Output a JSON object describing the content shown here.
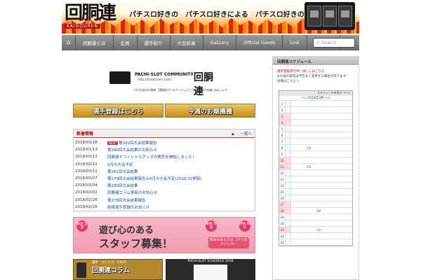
{
  "header": {
    "logo_text": "回胴連",
    "logo_sub": "KAIDOUREN",
    "tagline": "パチスロ好きの　パチスロ好きによる　パチスロ好きのための"
  },
  "nav": {
    "items": [
      "回胴連とは",
      "会員",
      "選手紹介",
      "大会結果",
      "GaLLery",
      "Official Goods",
      "Link",
      "お問合せ"
    ],
    "search_placeholder": "Search"
  },
  "community": {
    "name": "PACHI-SLOT COMMUNITY",
    "url": "http://kaidouren.com/",
    "kanji": "回胴連",
    "welcome": "パチスロ好きの皆様、回胴連のホームページへようこそ！パチスロを楽しみましょう！"
  },
  "banners": {
    "register": "選手登録はこちら",
    "theme": "今週のお題機種"
  },
  "news": {
    "title": "新着情報",
    "more": "一覧へ",
    "new_badge": "NEW!",
    "items": [
      {
        "date": "2018/03/18",
        "text": "第282回大会結果報告",
        "new": true
      },
      {
        "date": "2018/03/13",
        "text": "第280回大会結果のお知らせ",
        "new": false
      },
      {
        "date": "2018/03/13",
        "text": "回胴連オフィシャルグッズの販売を開始しました！",
        "new": false
      },
      {
        "date": "2018/03/12",
        "text": "5月の大会予定",
        "new": false
      },
      {
        "date": "2018/03/11",
        "text": "第281回大会結果",
        "new": false
      },
      {
        "date": "2018/03/07",
        "text": "第279回大会結果報告＆6月の大会予定(2018.02更新)",
        "new": false
      },
      {
        "date": "2018/03/04",
        "text": "第280回大会結果",
        "new": false
      },
      {
        "date": "2018/03/02",
        "text": "回胴連コラム更新のお知らせ",
        "new": false
      },
      {
        "date": "2018/02/28",
        "text": "第278回大会結果報告",
        "new": false
      },
      {
        "date": "2018/02/26",
        "text": "新規選手登録のお知らせ",
        "new": false
      }
    ]
  },
  "staff": {
    "badge_left": "動画 出演",
    "badge_right": "事務 作業",
    "badge_right2": "映像 制作",
    "line1": "遊び心のある",
    "line2": "スタッフ募集！",
    "apply": "興味のある方は コチラをクリック！"
  },
  "column": {
    "top": "選手　カントク　STAFF",
    "label": "回胴連コラム"
  },
  "schedule": {
    "title": "PACHI-SLOT SCHEDULE 2018"
  },
  "sidebar": {
    "title": "回胴連スケジュール",
    "notice1": "選手登録受付中！詳しくはこちら",
    "notice2": "※大会の日程は予告なく変更する場合があります",
    "notice3": "詳細はこちら＞",
    "cal_top": "スケジュールを見る >>>",
    "cal_month_prefix": "<< 2018年",
    "cal_month": "3月",
    "cal_month_suffix": " >>",
    "days": [
      {
        "d": "1",
        "hol": false,
        "text": ""
      },
      {
        "d": "2",
        "hol": false,
        "text": ""
      },
      {
        "d": "3",
        "hol": true,
        "text": ""
      },
      {
        "d": "4",
        "hol": true,
        "text": ""
      },
      {
        "d": "5",
        "hol": false,
        "text": ""
      },
      {
        "d": "6",
        "hol": false,
        "text": ""
      },
      {
        "d": "7",
        "hol": false,
        "text": ""
      },
      {
        "d": "8",
        "hol": false,
        "text": "CH"
      },
      {
        "d": "9",
        "hol": false,
        "text": ""
      },
      {
        "d": "10",
        "hol": true,
        "text": ""
      },
      {
        "d": "11",
        "hol": true,
        "text": "CH"
      },
      {
        "d": "12",
        "hol": false,
        "text": ""
      },
      {
        "d": "13",
        "hol": false,
        "text": ""
      },
      {
        "d": "14",
        "hol": false,
        "text": ""
      },
      {
        "d": "15",
        "hol": false,
        "text": ""
      },
      {
        "d": "16",
        "hol": false,
        "text": ""
      },
      {
        "d": "17",
        "hol": true,
        "text": ""
      },
      {
        "d": "18",
        "hol": true,
        "text": "CH"
      },
      {
        "d": "19",
        "hol": false,
        "text": ""
      },
      {
        "d": "20",
        "hol": false,
        "text": ""
      },
      {
        "d": "21",
        "hol": true,
        "text": "CH"
      },
      {
        "d": "22",
        "hol": false,
        "text": ""
      },
      {
        "d": "23",
        "hol": false,
        "text": ""
      },
      {
        "d": "24",
        "hol": true,
        "text": ""
      },
      {
        "d": "25",
        "hol": true,
        "text": "CH"
      },
      {
        "d": "26",
        "hol": false,
        "text": ""
      },
      {
        "d": "27",
        "hol": false,
        "text": ""
      }
    ]
  }
}
